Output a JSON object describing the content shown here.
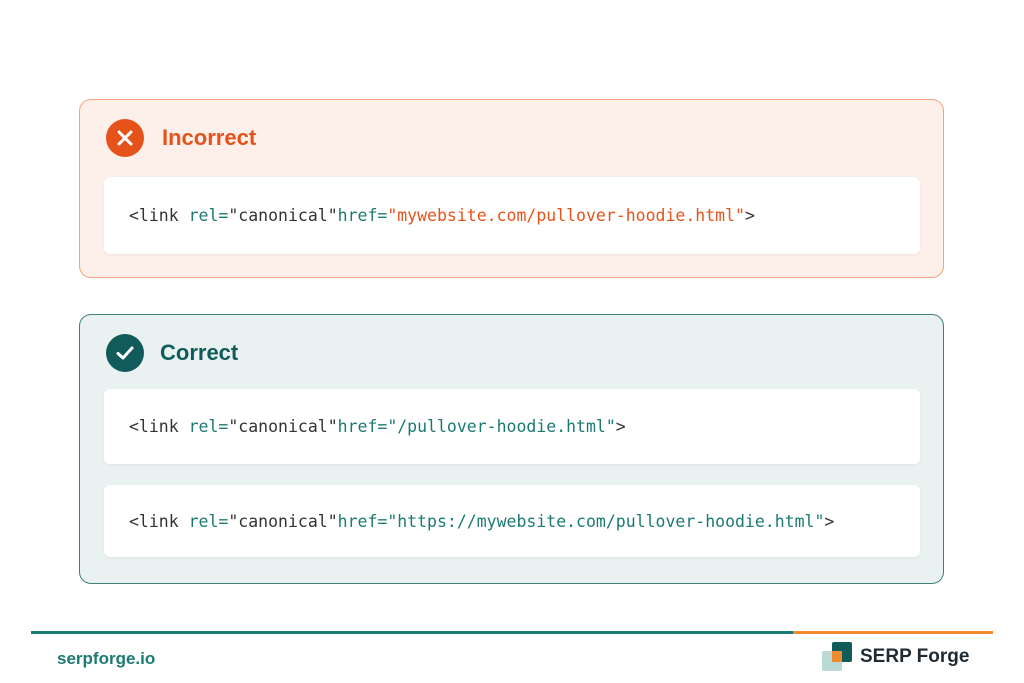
{
  "incorrect": {
    "title": "Incorrect",
    "icon": "close-icon",
    "accent": "#e6531a",
    "code": {
      "tag_open": "<link ",
      "rel_attr": "rel=",
      "rel_value": "\"canonical\"",
      "href_attr": "href=",
      "href_value": "\"mywebsite.com/pullover-hoodie.html\"",
      "tag_close": ">"
    }
  },
  "correct": {
    "title": "Correct",
    "icon": "check-icon",
    "accent": "#115c5a",
    "codes": [
      {
        "tag_open": "<link ",
        "rel_attr": "rel=",
        "rel_value": "\"canonical\"",
        "href_attr": "href=",
        "href_value": "\"/pullover-hoodie.html\"",
        "tag_close": ">"
      },
      {
        "tag_open": "<link ",
        "rel_attr": "rel=",
        "rel_value": "\"canonical\"",
        "href_attr": "href=",
        "href_value": "\"https://mywebsite.com/pullover-hoodie.html\"",
        "tag_close": ">"
      }
    ]
  },
  "footer": {
    "url": "serpforge.io",
    "brand_name": "SERP Forge",
    "teal": "#1b7a72",
    "orange": "#f28a2e"
  }
}
